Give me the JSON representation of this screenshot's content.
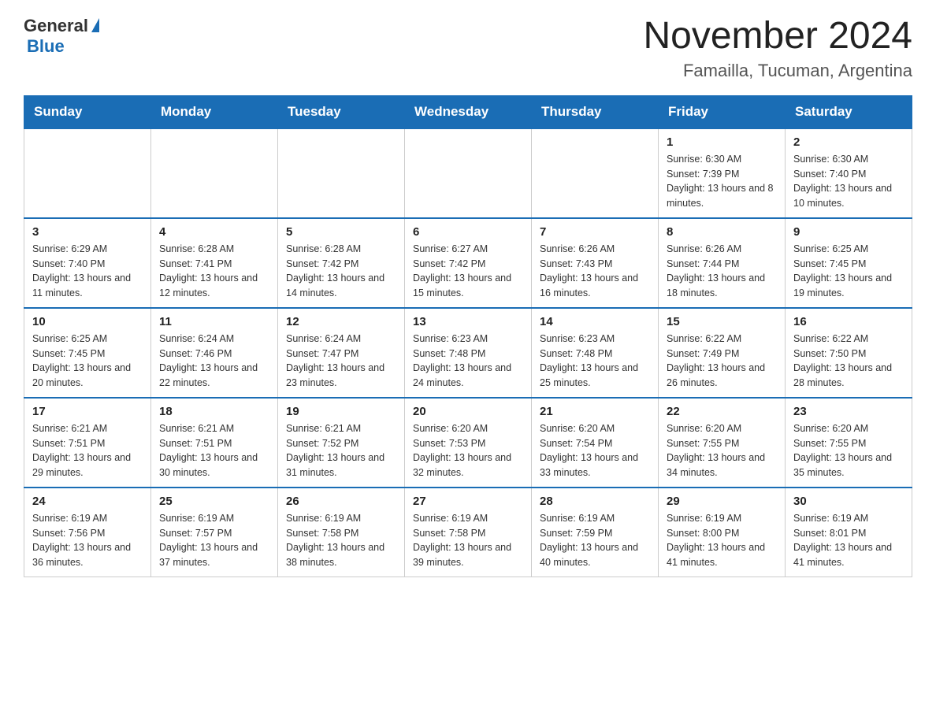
{
  "header": {
    "logo_general": "General",
    "logo_blue": "Blue",
    "month_title": "November 2024",
    "location": "Famailla, Tucuman, Argentina"
  },
  "days_of_week": [
    "Sunday",
    "Monday",
    "Tuesday",
    "Wednesday",
    "Thursday",
    "Friday",
    "Saturday"
  ],
  "weeks": [
    [
      {
        "day": "",
        "info": ""
      },
      {
        "day": "",
        "info": ""
      },
      {
        "day": "",
        "info": ""
      },
      {
        "day": "",
        "info": ""
      },
      {
        "day": "",
        "info": ""
      },
      {
        "day": "1",
        "info": "Sunrise: 6:30 AM\nSunset: 7:39 PM\nDaylight: 13 hours and 8 minutes."
      },
      {
        "day": "2",
        "info": "Sunrise: 6:30 AM\nSunset: 7:40 PM\nDaylight: 13 hours and 10 minutes."
      }
    ],
    [
      {
        "day": "3",
        "info": "Sunrise: 6:29 AM\nSunset: 7:40 PM\nDaylight: 13 hours and 11 minutes."
      },
      {
        "day": "4",
        "info": "Sunrise: 6:28 AM\nSunset: 7:41 PM\nDaylight: 13 hours and 12 minutes."
      },
      {
        "day": "5",
        "info": "Sunrise: 6:28 AM\nSunset: 7:42 PM\nDaylight: 13 hours and 14 minutes."
      },
      {
        "day": "6",
        "info": "Sunrise: 6:27 AM\nSunset: 7:42 PM\nDaylight: 13 hours and 15 minutes."
      },
      {
        "day": "7",
        "info": "Sunrise: 6:26 AM\nSunset: 7:43 PM\nDaylight: 13 hours and 16 minutes."
      },
      {
        "day": "8",
        "info": "Sunrise: 6:26 AM\nSunset: 7:44 PM\nDaylight: 13 hours and 18 minutes."
      },
      {
        "day": "9",
        "info": "Sunrise: 6:25 AM\nSunset: 7:45 PM\nDaylight: 13 hours and 19 minutes."
      }
    ],
    [
      {
        "day": "10",
        "info": "Sunrise: 6:25 AM\nSunset: 7:45 PM\nDaylight: 13 hours and 20 minutes."
      },
      {
        "day": "11",
        "info": "Sunrise: 6:24 AM\nSunset: 7:46 PM\nDaylight: 13 hours and 22 minutes."
      },
      {
        "day": "12",
        "info": "Sunrise: 6:24 AM\nSunset: 7:47 PM\nDaylight: 13 hours and 23 minutes."
      },
      {
        "day": "13",
        "info": "Sunrise: 6:23 AM\nSunset: 7:48 PM\nDaylight: 13 hours and 24 minutes."
      },
      {
        "day": "14",
        "info": "Sunrise: 6:23 AM\nSunset: 7:48 PM\nDaylight: 13 hours and 25 minutes."
      },
      {
        "day": "15",
        "info": "Sunrise: 6:22 AM\nSunset: 7:49 PM\nDaylight: 13 hours and 26 minutes."
      },
      {
        "day": "16",
        "info": "Sunrise: 6:22 AM\nSunset: 7:50 PM\nDaylight: 13 hours and 28 minutes."
      }
    ],
    [
      {
        "day": "17",
        "info": "Sunrise: 6:21 AM\nSunset: 7:51 PM\nDaylight: 13 hours and 29 minutes."
      },
      {
        "day": "18",
        "info": "Sunrise: 6:21 AM\nSunset: 7:51 PM\nDaylight: 13 hours and 30 minutes."
      },
      {
        "day": "19",
        "info": "Sunrise: 6:21 AM\nSunset: 7:52 PM\nDaylight: 13 hours and 31 minutes."
      },
      {
        "day": "20",
        "info": "Sunrise: 6:20 AM\nSunset: 7:53 PM\nDaylight: 13 hours and 32 minutes."
      },
      {
        "day": "21",
        "info": "Sunrise: 6:20 AM\nSunset: 7:54 PM\nDaylight: 13 hours and 33 minutes."
      },
      {
        "day": "22",
        "info": "Sunrise: 6:20 AM\nSunset: 7:55 PM\nDaylight: 13 hours and 34 minutes."
      },
      {
        "day": "23",
        "info": "Sunrise: 6:20 AM\nSunset: 7:55 PM\nDaylight: 13 hours and 35 minutes."
      }
    ],
    [
      {
        "day": "24",
        "info": "Sunrise: 6:19 AM\nSunset: 7:56 PM\nDaylight: 13 hours and 36 minutes."
      },
      {
        "day": "25",
        "info": "Sunrise: 6:19 AM\nSunset: 7:57 PM\nDaylight: 13 hours and 37 minutes."
      },
      {
        "day": "26",
        "info": "Sunrise: 6:19 AM\nSunset: 7:58 PM\nDaylight: 13 hours and 38 minutes."
      },
      {
        "day": "27",
        "info": "Sunrise: 6:19 AM\nSunset: 7:58 PM\nDaylight: 13 hours and 39 minutes."
      },
      {
        "day": "28",
        "info": "Sunrise: 6:19 AM\nSunset: 7:59 PM\nDaylight: 13 hours and 40 minutes."
      },
      {
        "day": "29",
        "info": "Sunrise: 6:19 AM\nSunset: 8:00 PM\nDaylight: 13 hours and 41 minutes."
      },
      {
        "day": "30",
        "info": "Sunrise: 6:19 AM\nSunset: 8:01 PM\nDaylight: 13 hours and 41 minutes."
      }
    ]
  ]
}
